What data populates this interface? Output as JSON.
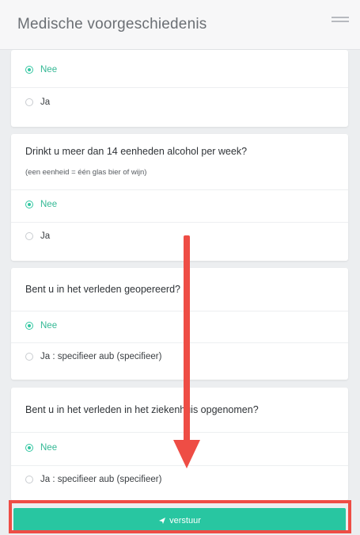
{
  "header": {
    "title": "Medische voorgeschiedenis"
  },
  "questions": [
    {
      "text": "",
      "subtext": "",
      "options": [
        {
          "label": "Nee",
          "selected": true
        },
        {
          "label": "Ja",
          "selected": false
        }
      ]
    },
    {
      "text": "Drinkt u meer dan 14 eenheden alcohol per week?",
      "subtext": "(een eenheid = één glas bier of wijn)",
      "options": [
        {
          "label": "Nee",
          "selected": true
        },
        {
          "label": "Ja",
          "selected": false
        }
      ]
    },
    {
      "text": "Bent u in het verleden geopereerd?",
      "subtext": "",
      "options": [
        {
          "label": "Nee",
          "selected": true
        },
        {
          "label": "Ja : specifieer aub (specifieer)",
          "selected": false
        }
      ]
    },
    {
      "text": "Bent u in het verleden in het ziekenhuis opgenomen?",
      "subtext": "",
      "options": [
        {
          "label": "Nee",
          "selected": true
        },
        {
          "label": "Ja : specifieer aub (specifieer)",
          "selected": false
        }
      ]
    }
  ],
  "submit": {
    "label": "verstuur",
    "icon": "send-icon"
  },
  "colors": {
    "accent": "#28c6a1",
    "annotation": "#ee4d45"
  }
}
